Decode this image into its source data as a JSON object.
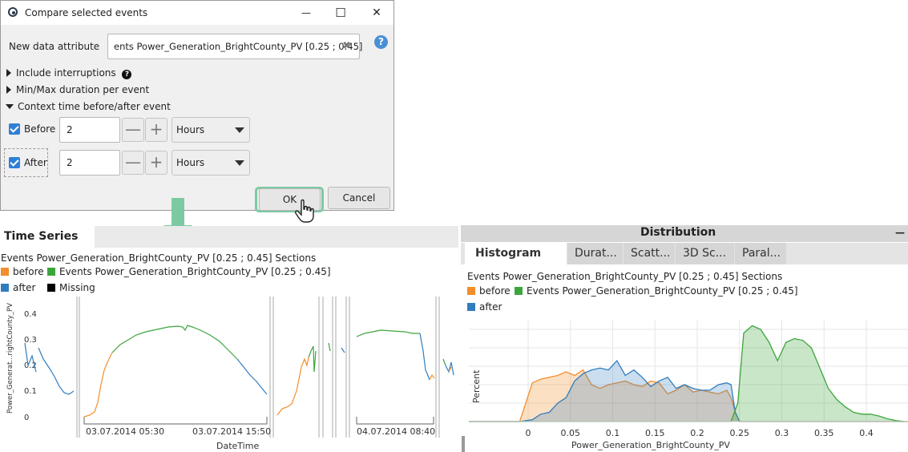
{
  "dialog": {
    "title": "Compare selected events",
    "new_attr_label": "New data attribute",
    "new_attr_value": "ents Power_Generation_BrightCounty_PV [0.25 ; 0.45]",
    "include_interruptions": "Include interruptions",
    "minmax_duration": "Min/Max duration per event",
    "context_time": "Context time before/after event",
    "before_label": "Before",
    "before_value": "2",
    "before_unit": "Hours",
    "after_label": "After",
    "after_value": "2",
    "after_unit": "Hours",
    "ok": "OK",
    "cancel": "Cancel",
    "minimize": "—",
    "maximize": "☐",
    "close": "✕",
    "clear": "✖",
    "help": "?",
    "info": "?",
    "minus": "—",
    "plus": "+"
  },
  "colors": {
    "before": "#f28e2b",
    "events": "#3ca53c",
    "after": "#2f7dbf",
    "missing": "#000000",
    "ok_highlight": "#7cc9a2"
  },
  "timeseries": {
    "header": "Time Series",
    "subtitle": "Events Power_Generation_BrightCounty_PV [0.25 ; 0.45] Sections",
    "legend": {
      "before": "before",
      "events": "Events Power_Generation_BrightCounty_PV [0.25 ; 0.45]",
      "after": "after",
      "missing": "Missing"
    },
    "ylabel": "Power_Generat...rightCounty_PV",
    "xlabel": "DateTime",
    "yticks": [
      "0.4",
      "0.3",
      "0.2",
      "0.1",
      "0"
    ],
    "xticks": [
      "03.07.2014 05:30",
      "03.07.2014 15:50",
      "04.07.2014 08:40"
    ]
  },
  "distribution": {
    "header": "Distribution",
    "collapse": "—",
    "tabs": [
      "Histogram",
      "Durat...",
      "Scatt...",
      "3D Sc...",
      "Paral..."
    ],
    "subtitle": "Events Power_Generation_BrightCounty_PV [0.25 ; 0.45] Sections",
    "legend": {
      "before": "before",
      "events": "Events Power_Generation_BrightCounty_PV [0.25 ; 0.45]",
      "after": "after"
    }
  },
  "chart_data": {
    "type": "area",
    "xlabel": "Power_Generation_BrightCounty_PV",
    "ylabel": "Percent",
    "xlim": [
      -0.07,
      0.45
    ],
    "ylim": [
      0,
      11
    ],
    "xticks": [
      0,
      0.05,
      0.1,
      0.15,
      0.2,
      0.25,
      0.3,
      0.35,
      0.4
    ],
    "yticks": [
      2,
      4,
      6,
      8,
      10
    ],
    "grid": true,
    "legend_position": "top-left",
    "series": [
      {
        "name": "before",
        "color": "#f28e2b",
        "x": [
          -0.07,
          -0.01,
          0.005,
          0.015,
          0.025,
          0.035,
          0.045,
          0.055,
          0.065,
          0.075,
          0.085,
          0.095,
          0.105,
          0.115,
          0.125,
          0.135,
          0.145,
          0.155,
          0.165,
          0.175,
          0.185,
          0.195,
          0.205,
          0.215,
          0.225,
          0.235,
          0.24,
          0.245,
          0.25,
          0.45
        ],
        "y": [
          0,
          0,
          4.2,
          4.6,
          4.8,
          5.0,
          5.4,
          5.0,
          5.6,
          4.0,
          3.6,
          4.0,
          4.2,
          4.4,
          4.0,
          3.8,
          4.4,
          4.2,
          3.0,
          3.4,
          4.0,
          3.2,
          3.4,
          3.2,
          3.0,
          3.4,
          2.6,
          1.0,
          0,
          0
        ]
      },
      {
        "name": "after",
        "color": "#2f7dbf",
        "x": [
          -0.07,
          -0.01,
          0.005,
          0.015,
          0.025,
          0.035,
          0.045,
          0.055,
          0.065,
          0.075,
          0.085,
          0.095,
          0.105,
          0.115,
          0.125,
          0.135,
          0.145,
          0.155,
          0.165,
          0.175,
          0.185,
          0.195,
          0.205,
          0.215,
          0.225,
          0.235,
          0.24,
          0.245,
          0.25,
          0.45
        ],
        "y": [
          0,
          0,
          0.2,
          0.8,
          1.0,
          2.0,
          2.6,
          4.4,
          5.2,
          5.6,
          5.8,
          5.6,
          6.6,
          5.0,
          5.6,
          4.8,
          3.8,
          4.4,
          4.8,
          3.6,
          4.0,
          3.6,
          3.4,
          3.4,
          4.0,
          4.2,
          4.0,
          1.0,
          0,
          0
        ]
      },
      {
        "name": "Events Power_Generation_BrightCounty_PV [0.25 ; 0.45]",
        "color": "#3ca53c",
        "x": [
          -0.07,
          0.24,
          0.248,
          0.255,
          0.265,
          0.275,
          0.285,
          0.295,
          0.305,
          0.315,
          0.325,
          0.335,
          0.345,
          0.355,
          0.365,
          0.375,
          0.385,
          0.395,
          0.405,
          0.415,
          0.425,
          0.435,
          0.445
        ],
        "y": [
          0,
          0,
          2.0,
          9.6,
          10.4,
          10.0,
          8.6,
          6.6,
          8.6,
          9.0,
          8.8,
          8.0,
          5.8,
          3.6,
          2.4,
          1.6,
          1.0,
          0.8,
          0.8,
          0.6,
          0.3,
          0.1,
          0
        ]
      }
    ]
  }
}
